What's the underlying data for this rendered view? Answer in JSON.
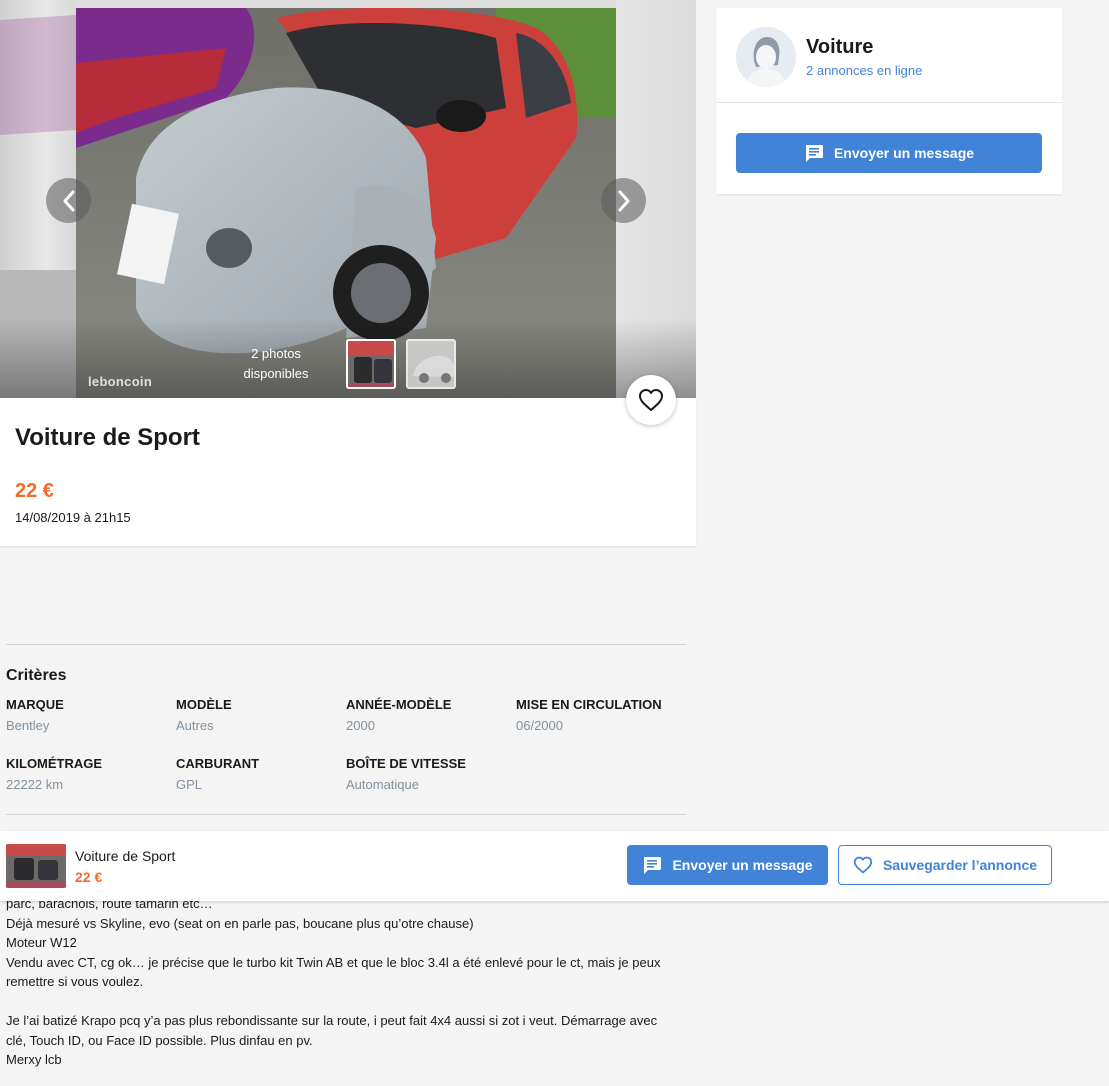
{
  "gallery": {
    "watermark": "leboncoin",
    "photo_count_line1": "2 photos",
    "photo_count_line2": "disponibles",
    "thumbnails": [
      "car-interior",
      "car-exterior"
    ],
    "prev_icon": "chevron-left-icon",
    "next_icon": "chevron-right-icon"
  },
  "ad": {
    "title": "Voiture de Sport",
    "price": "22 €",
    "date": "14/08/2019 à 21h15",
    "favorite_icon": "heart-icon"
  },
  "seller": {
    "name": "Voiture",
    "listings": "2 annonces en ligne",
    "message_button": "Envoyer un message",
    "message_icon": "chat-icon"
  },
  "criteria": {
    "title": "Critères",
    "items": [
      {
        "label": "MARQUE",
        "value": "Bentley"
      },
      {
        "label": "MODÈLE",
        "value": "Autres"
      },
      {
        "label": "ANNÉE-MODÈLE",
        "value": "2000"
      },
      {
        "label": "MISE EN CIRCULATION",
        "value": "06/2000"
      },
      {
        "label": "KILOMÉTRAGE",
        "value": "22222 km"
      },
      {
        "label": "CARBURANT",
        "value": "GPL"
      },
      {
        "label": "BOÎTE DE VITESSE",
        "value": "Automatique"
      }
    ]
  },
  "sticky": {
    "title": "Voiture de Sport",
    "price": "22 €",
    "message_button": "Envoyer un message",
    "save_button": "Sauvegarder l’annonce"
  },
  "description": {
    "lines": [
      "parc, barachois, route tamarin etc…",
      "Déjà mesuré vs Skyline, evo (seat on en parle pas, boucane plus qu’otre chause)",
      "Moteur W12",
      "Vendu avec CT, cg ok… je précise que le turbo kit Twin AB et que le bloc 3.4l a été enlevé pour le ct, mais je peux",
      "remettre si vous voulez.",
      "",
      "Je l’ai batizé Krapo pcq y’a pas plus rebondissante sur la route, i peut fait 4x4 aussi si zot i veut. Démarrage avec",
      "clé, Touch ID, ou Face ID possible. Plus dinfau en pv.",
      "Merxy lcb"
    ]
  },
  "colors": {
    "accent_blue": "#4183d7",
    "price_orange": "#f56b2a",
    "muted_value": "#8191a0"
  }
}
